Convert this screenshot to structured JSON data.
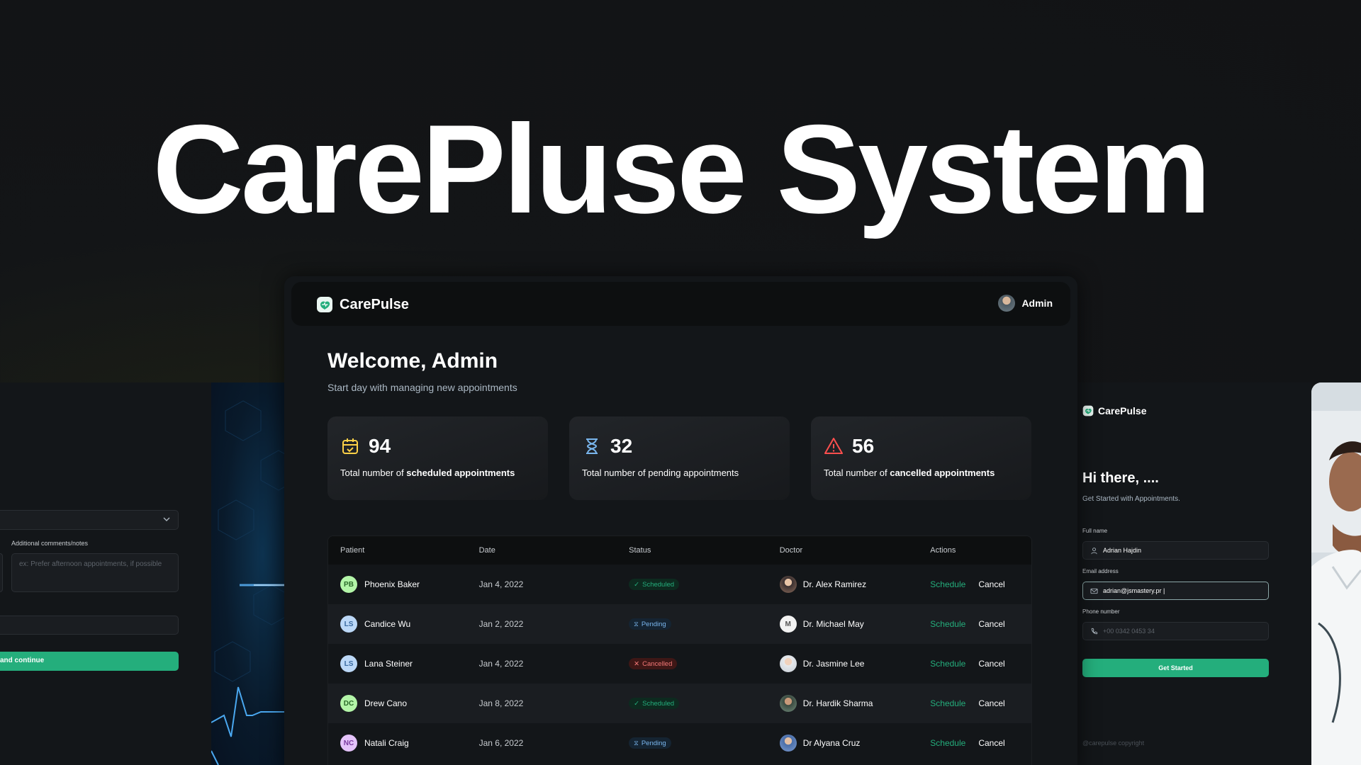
{
  "hero": {
    "title": "CarePluse System"
  },
  "left_panel": {
    "comments_label": "Additional comments/notes",
    "comments_placeholder": "ex: Prefer afternoon appointments, if possible",
    "submit_label": "and continue"
  },
  "dashboard": {
    "brand": "CarePulse",
    "admin_label": "Admin",
    "welcome_title": "Welcome, Admin",
    "welcome_sub": "Start day with managing new appointments",
    "stats": [
      {
        "icon": "calendar-icon",
        "count": "94",
        "prefix": "Total number of ",
        "emph": "scheduled appointments",
        "color": "#ffd147"
      },
      {
        "icon": "hourglass-icon",
        "count": "32",
        "prefix": "Total number of pending appointments",
        "emph": "",
        "color": "#79b5ec"
      },
      {
        "icon": "warning-icon",
        "count": "56",
        "prefix": "Total number of ",
        "emph": "cancelled appointments",
        "color": "#ff4f4e"
      }
    ],
    "table": {
      "headers": [
        "Patient",
        "Date",
        "Status",
        "Doctor",
        "Actions"
      ],
      "rows": [
        {
          "initials": "PB",
          "patient": "Phoenix Baker",
          "date": "Jan 4, 2022",
          "status": "Scheduled",
          "doctor": "Dr. Alex Ramirez",
          "avatar_bg": "#b3f5a8",
          "avatar_fg": "#2b6b2a"
        },
        {
          "initials": "LS",
          "patient": "Candice Wu",
          "date": "Jan 2, 2022",
          "status": "Pending",
          "doctor": "Dr. Michael May",
          "avatar_bg": "#bcd8f7",
          "avatar_fg": "#3a6aa0"
        },
        {
          "initials": "LS",
          "patient": "Lana Steiner",
          "date": "Jan 4, 2022",
          "status": "Cancelled",
          "doctor": "Dr. Jasmine Lee",
          "avatar_bg": "#bcd8f7",
          "avatar_fg": "#3a6aa0"
        },
        {
          "initials": "DC",
          "patient": "Drew Cano",
          "date": "Jan 8, 2022",
          "status": "Scheduled",
          "doctor": "Dr. Hardik Sharma",
          "avatar_bg": "#b3f5a8",
          "avatar_fg": "#2b6b2a"
        },
        {
          "initials": "NC",
          "patient": "Natali Craig",
          "date": "Jan 6, 2022",
          "status": "Pending",
          "doctor": "Dr Alyana Cruz",
          "avatar_bg": "#e4c3fa",
          "avatar_fg": "#7a3b9e"
        }
      ],
      "schedule_label": "Schedule",
      "cancel_label": "Cancel"
    }
  },
  "right_panel": {
    "brand": "CarePulse",
    "greeting": "Hi there, ....",
    "subtitle": "Get Started with Appointments.",
    "fullname_label": "Full name",
    "fullname_value": "Adrian Hajdin",
    "email_label": "Email address",
    "email_value": "adrian@jsmastery.pr |",
    "phone_label": "Phone number",
    "phone_placeholder": "+00 0342 0453 34",
    "button_label": "Get Started",
    "copyright": "@carepulse copyright"
  },
  "colors": {
    "accent_green": "#24ae7c",
    "background": "#131619",
    "header": "#0d0f10"
  }
}
